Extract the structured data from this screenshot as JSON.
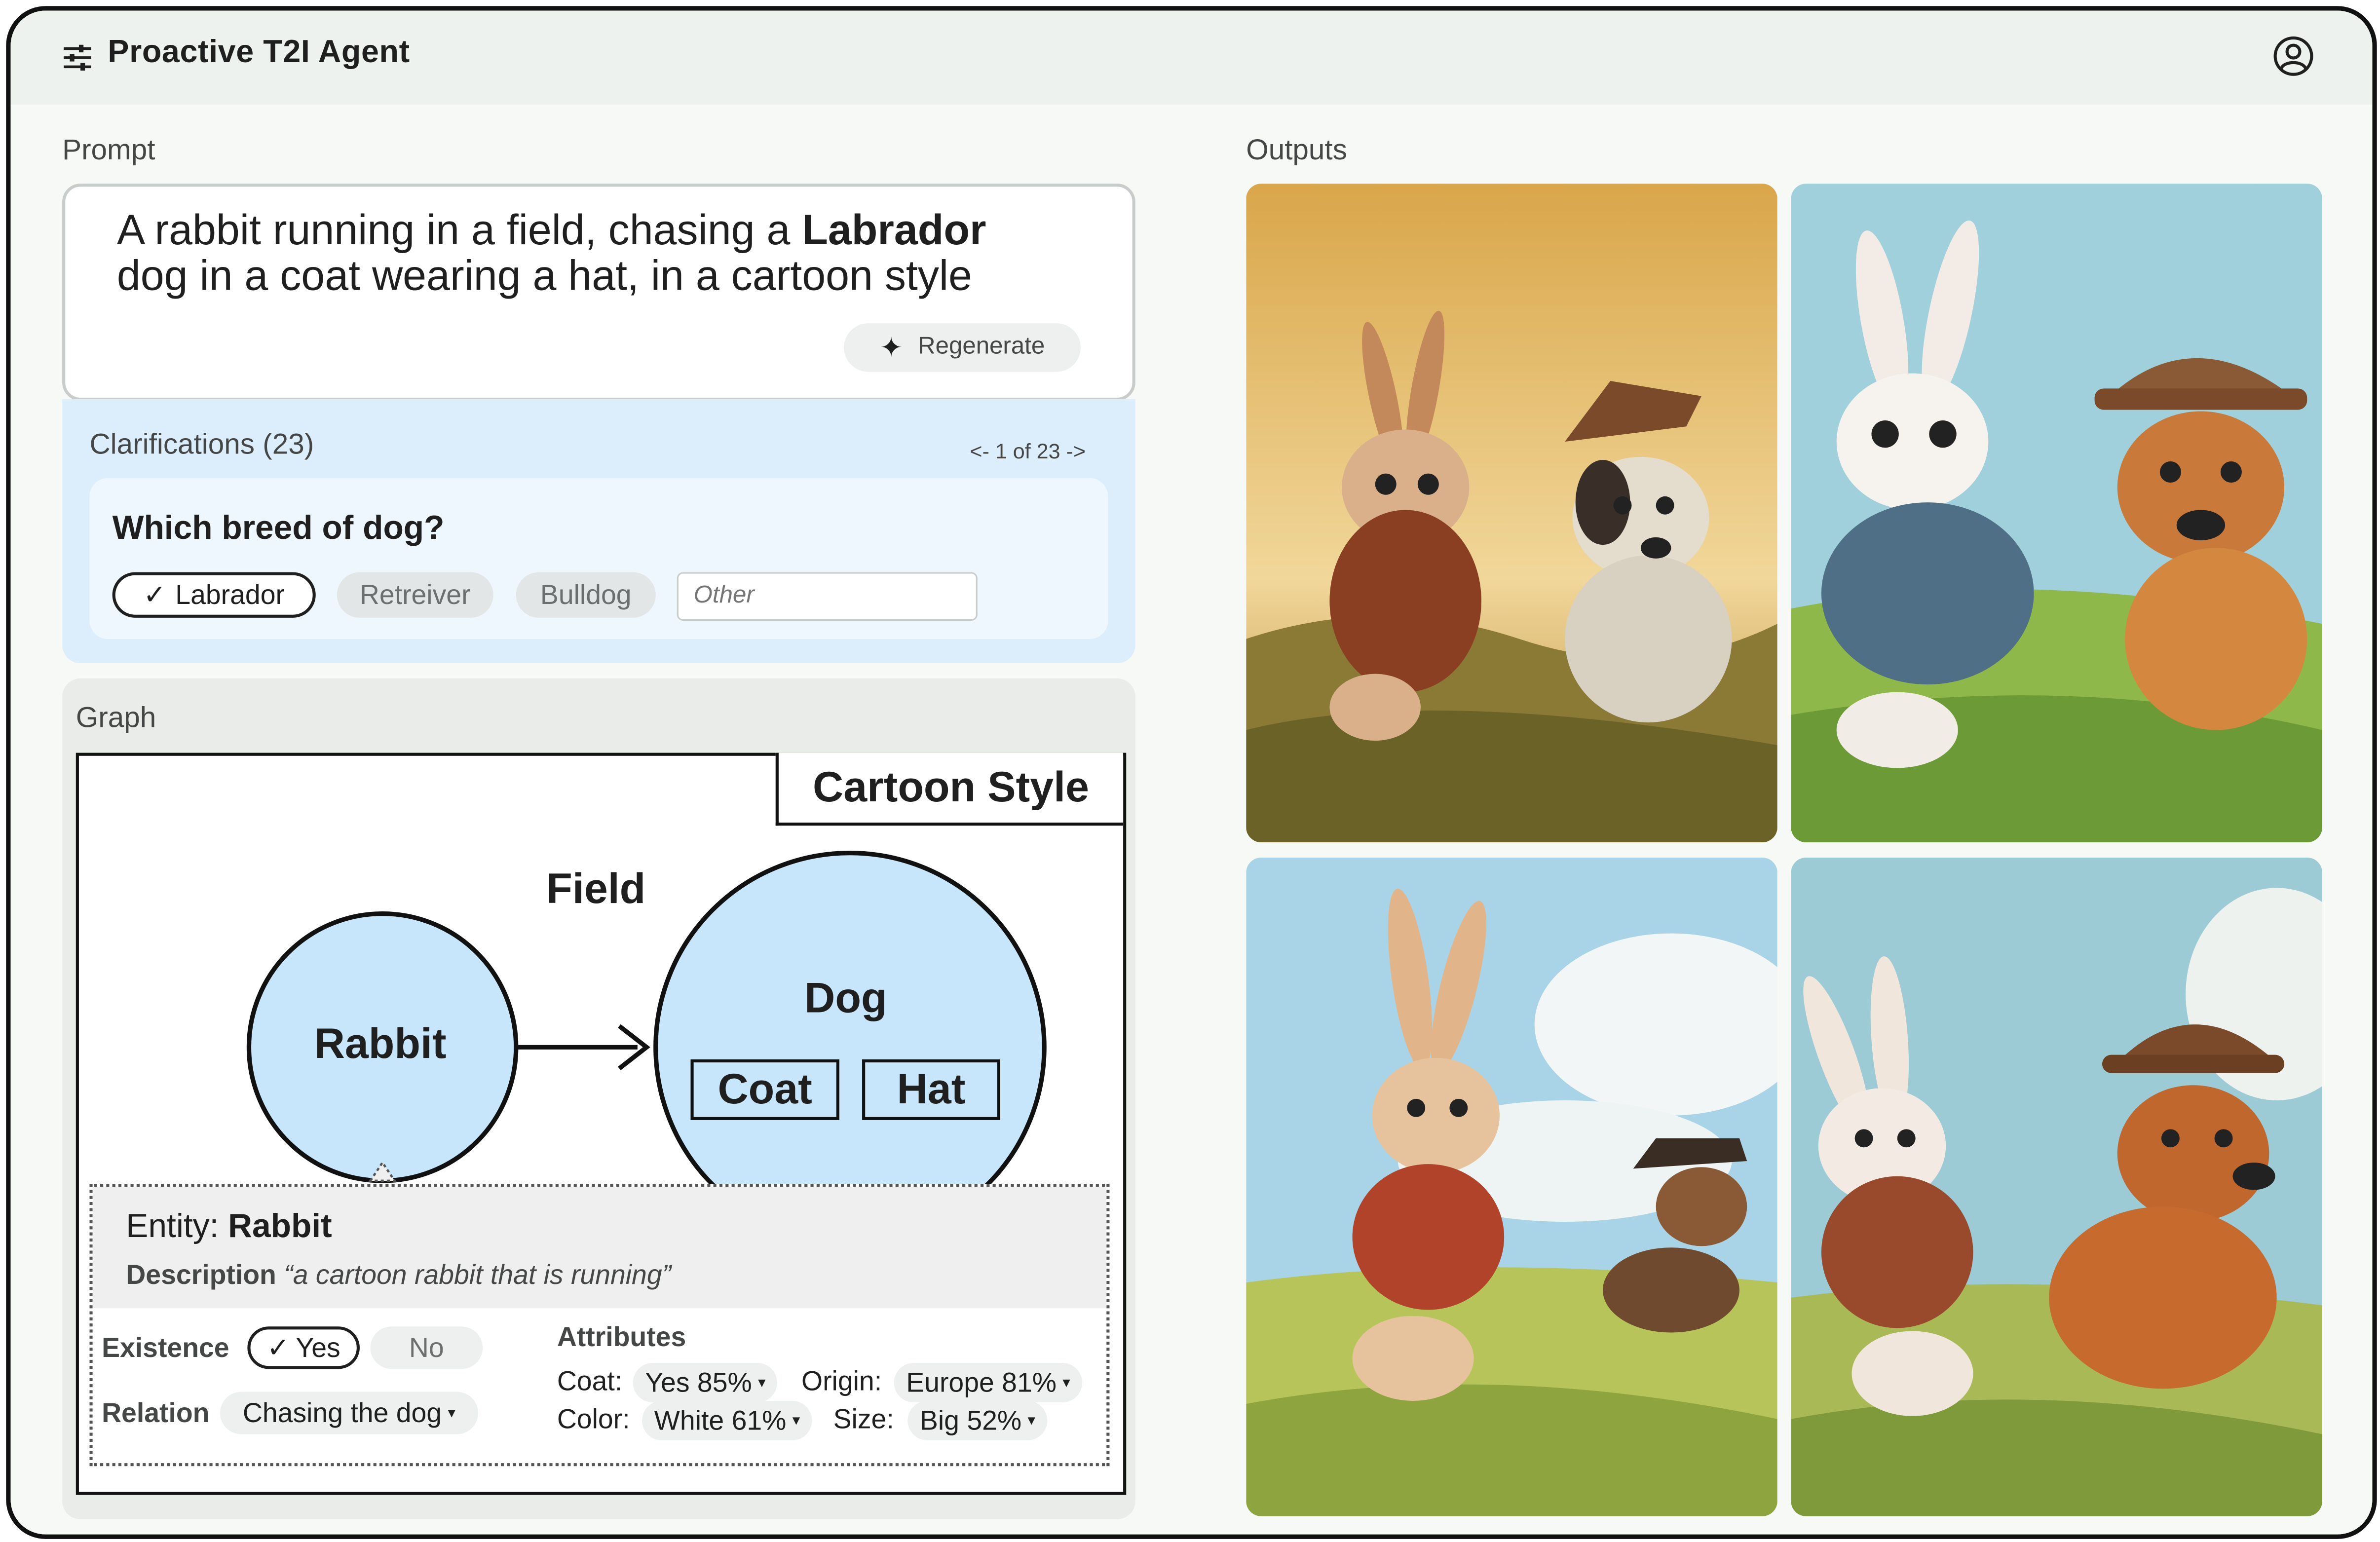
{
  "app": {
    "title": "Proactive T2I Agent",
    "icon": "tune-icon",
    "account_icon": "account-circle-icon"
  },
  "prompt": {
    "section_label": "Prompt",
    "text_before": "A rabbit running in a field, chasing a ",
    "text_bold": "Labrador",
    "text_after": "dog in a coat wearing a hat, in a cartoon style",
    "regenerate_label": "Regenerate",
    "regenerate_icon": "sparkle-icon"
  },
  "clarifications": {
    "title": "Clarifications (23)",
    "pager": "<- 1 of 23 ->",
    "question": "Which breed of dog?",
    "selected_option": "Labrador",
    "options": [
      "Retreiver",
      "Bulldog"
    ],
    "other_placeholder": "Other"
  },
  "graph": {
    "section_label": "Graph",
    "style_node": "Cartoon Style",
    "scene_node": "Field",
    "entities": [
      {
        "name": "Rabbit"
      },
      {
        "name": "Dog",
        "attributes": [
          "Coat",
          "Hat"
        ]
      }
    ],
    "relation": {
      "from": "Rabbit",
      "to": "Dog"
    },
    "popup": {
      "entity_prefix": "Entity: ",
      "entity_name": "Rabbit",
      "description_label": "Description",
      "description_text": "“a cartoon rabbit that is running”",
      "existence_label": "Existence",
      "existence_yes": "Yes",
      "existence_no": "No",
      "relation_label": "Relation",
      "relation_value": "Chasing the dog",
      "attributes_label": "Attributes",
      "attributes": [
        {
          "key": "Coat:",
          "value": "Yes 85%"
        },
        {
          "key": "Origin:",
          "value": "Europe 81%"
        },
        {
          "key": "Color:",
          "value": "White 61%"
        },
        {
          "key": "Size:",
          "value": "Big 52%"
        }
      ]
    }
  },
  "outputs": {
    "section_label": "Outputs",
    "images": [
      {
        "name": "output-image-1"
      },
      {
        "name": "output-image-2"
      },
      {
        "name": "output-image-3"
      },
      {
        "name": "output-image-4"
      }
    ]
  },
  "colors": {
    "accent_blue": "#c7e6fb",
    "panel_blue": "#dceefc",
    "topbar": "#eef2ef"
  }
}
